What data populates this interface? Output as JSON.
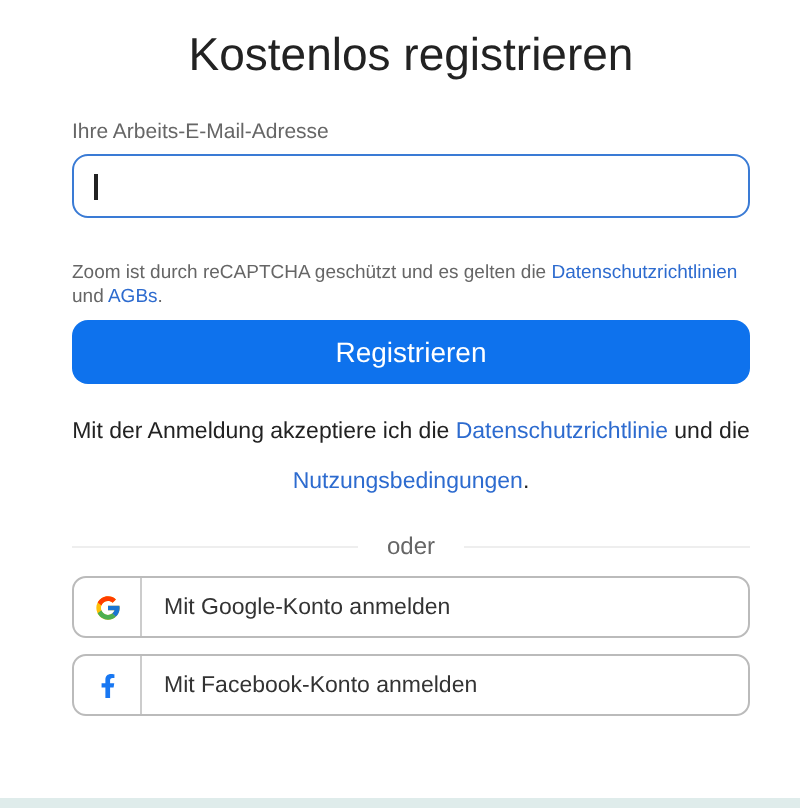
{
  "title": "Kostenlos registrieren",
  "email": {
    "label": "Ihre Arbeits-E-Mail-Adresse",
    "focused": true
  },
  "recaptcha": [
    {
      "kind": "text",
      "text": "Zoom ist durch reCAPTCHA geschützt und es gelten die "
    },
    {
      "kind": "link",
      "text": "Datenschutzrichtlinien"
    },
    {
      "kind": "text",
      "text": " und "
    },
    {
      "kind": "link",
      "text": "AGBs"
    },
    {
      "kind": "text",
      "text": "."
    }
  ],
  "submit": "Registrieren",
  "consent": [
    {
      "kind": "text",
      "text": "Mit der Anmeldung akzeptiere ich die "
    },
    {
      "kind": "link",
      "text": "Datenschutzrichtlinie"
    },
    {
      "kind": "text",
      "text": " und die "
    },
    {
      "kind": "link",
      "text": "Nutzungsbedingungen"
    },
    {
      "kind": "text",
      "text": "."
    }
  ],
  "divider": "oder",
  "social": [
    {
      "kind": "google",
      "label": "Mit Google-Konto anmelden"
    },
    {
      "kind": "facebook",
      "label": "Mit Facebook-Konto anmelden"
    }
  ]
}
